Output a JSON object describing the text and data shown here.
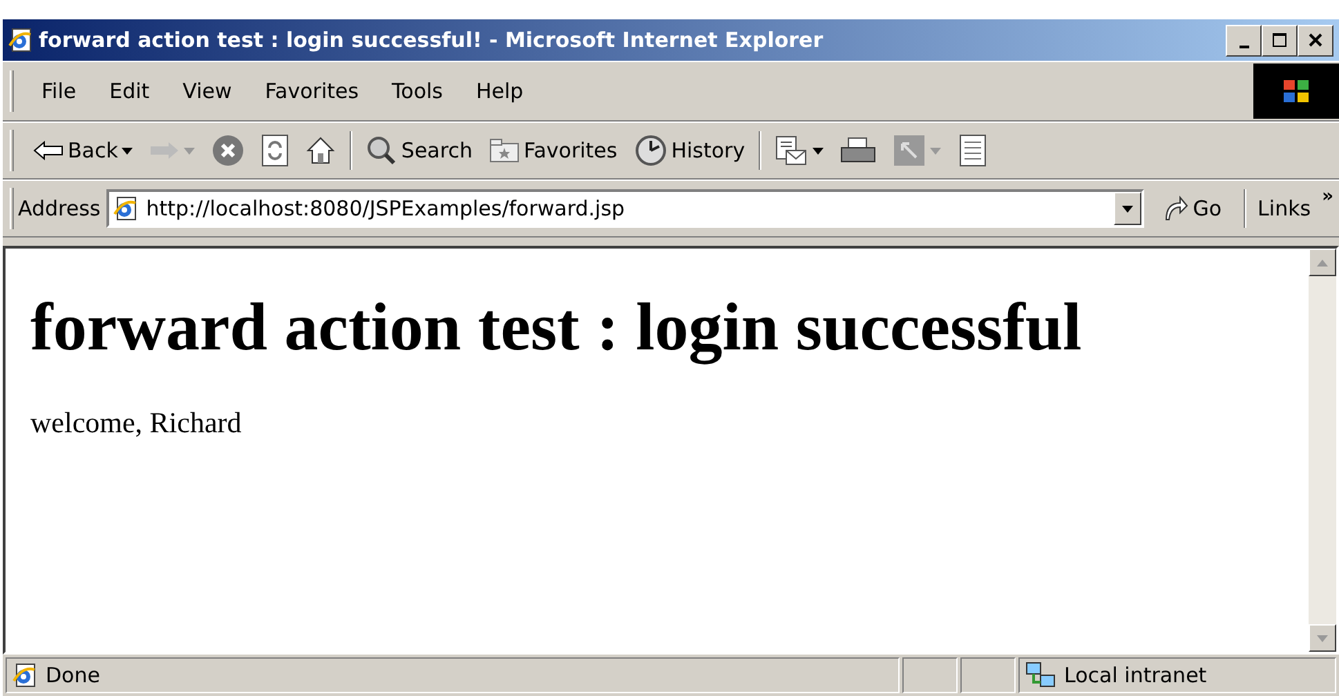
{
  "window": {
    "title": "forward action test : login successful! - Microsoft Internet Explorer"
  },
  "menu": [
    "File",
    "Edit",
    "View",
    "Favorites",
    "Tools",
    "Help"
  ],
  "toolbar": [
    {
      "label": "Back"
    },
    {
      "label": "Search"
    },
    {
      "label": "Favorites"
    },
    {
      "label": "History"
    }
  ],
  "address_bar": {
    "label": "Address",
    "url": "http://localhost:8080/JSPExamples/forward.jsp",
    "go": "Go",
    "links": "Links",
    "more": "»"
  },
  "page": {
    "heading": "forward action test : login successful",
    "text": "welcome, Richard"
  },
  "status_bar": {
    "text": "Done",
    "zone": "Local intranet"
  }
}
